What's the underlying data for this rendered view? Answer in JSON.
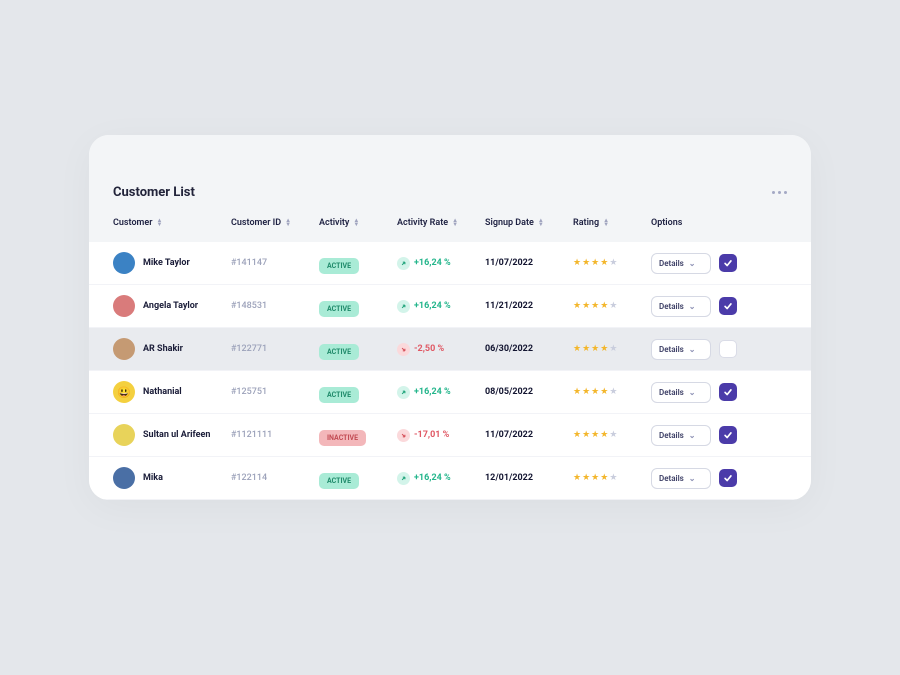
{
  "title": "Customer List",
  "columns": {
    "customer": "Customer",
    "customer_id": "Customer ID",
    "activity": "Activity",
    "activity_rate": "Activity Rate",
    "signup_date": "Signup Date",
    "rating": "Rating",
    "options": "Options"
  },
  "details_label": "Details",
  "status_labels": {
    "active": "ACTIVE",
    "inactive": "INACTIVE"
  },
  "rows": [
    {
      "name": "Mike Taylor",
      "id": "#141147",
      "activity": "active",
      "rate": "+16,24 %",
      "trend": "up",
      "date": "11/07/2022",
      "rating": 4,
      "checked": true,
      "selected": false,
      "avatar_bg": "#3B82C4"
    },
    {
      "name": "Angela Taylor",
      "id": "#148531",
      "activity": "active",
      "rate": "+16,24 %",
      "trend": "up",
      "date": "11/21/2022",
      "rating": 4,
      "checked": true,
      "selected": false,
      "avatar_bg": "#D97B7B"
    },
    {
      "name": "AR Shakir",
      "id": "#122771",
      "activity": "active",
      "rate": "-2,50 %",
      "trend": "down",
      "date": "06/30/2022",
      "rating": 4,
      "checked": false,
      "selected": true,
      "avatar_bg": "#C59A73"
    },
    {
      "name": "Nathanial",
      "id": "#125751",
      "activity": "active",
      "rate": "+16,24 %",
      "trend": "up",
      "date": "08/05/2022",
      "rating": 4,
      "checked": true,
      "selected": false,
      "avatar_bg": "#F4D03F"
    },
    {
      "name": "Sultan ul Arifeen",
      "id": "#1121111",
      "activity": "inactive",
      "rate": "-17,01 %",
      "trend": "down",
      "date": "11/07/2022",
      "rating": 4,
      "checked": true,
      "selected": false,
      "avatar_bg": "#E8D35A"
    },
    {
      "name": "Mika",
      "id": "#122114",
      "activity": "active",
      "rate": "+16,24 %",
      "trend": "up",
      "date": "12/01/2022",
      "rating": 4,
      "checked": true,
      "selected": false,
      "avatar_bg": "#4A6FA5"
    }
  ]
}
